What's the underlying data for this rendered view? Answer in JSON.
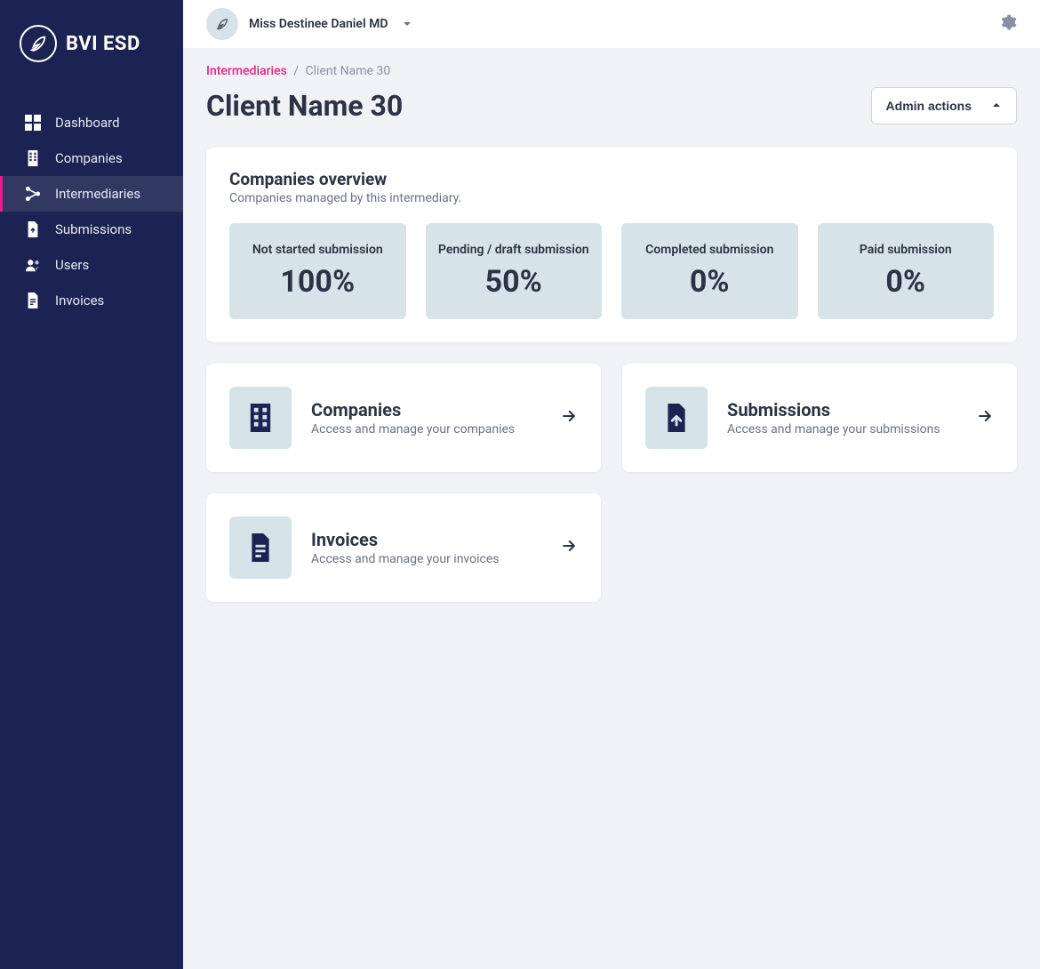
{
  "logo": {
    "text": "BVI ESD",
    "icon": "feather-icon"
  },
  "sidebar": {
    "activeIndex": 2,
    "items": [
      {
        "label": "Dashboard",
        "icon": "dashboard-icon"
      },
      {
        "label": "Companies",
        "icon": "companies-icon"
      },
      {
        "label": "Intermediaries",
        "icon": "intermediaries-icon"
      },
      {
        "label": "Submissions",
        "icon": "submissions-icon"
      },
      {
        "label": "Users",
        "icon": "users-icon"
      },
      {
        "label": "Invoices",
        "icon": "invoices-icon"
      }
    ]
  },
  "header": {
    "user_name": "Miss Destinee Daniel MD"
  },
  "breadcrumb": {
    "parent": "Intermediaries",
    "separator": "/",
    "current": "Client Name 30"
  },
  "page": {
    "title": "Client Name 30",
    "admin_actions_label": "Admin actions"
  },
  "overview": {
    "title": "Companies overview",
    "subtitle": "Companies managed by this intermediary.",
    "stats": [
      {
        "label": "Not started submission",
        "value": "100%"
      },
      {
        "label": "Pending / draft submission",
        "value": "50%"
      },
      {
        "label": "Completed submission",
        "value": "0%"
      },
      {
        "label": "Paid submission",
        "value": "0%"
      }
    ]
  },
  "links": [
    {
      "title": "Companies",
      "subtitle": "Access and manage your companies",
      "icon": "building-icon"
    },
    {
      "title": "Submissions",
      "subtitle": "Access and manage your submissions",
      "icon": "file-upload-icon"
    },
    {
      "title": "Invoices",
      "subtitle": "Access and manage your invoices",
      "icon": "file-lines-icon"
    }
  ]
}
